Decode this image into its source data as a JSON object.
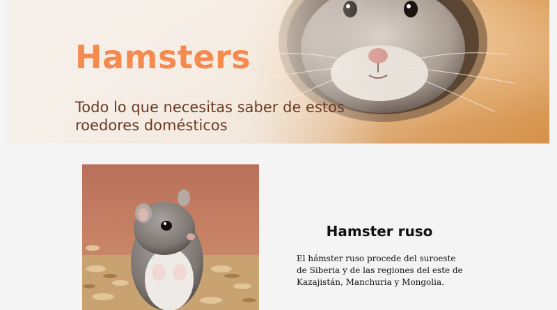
{
  "hero": {
    "title": "Hamsters",
    "subtitle": "Todo lo que necesitas saber de estos roedores domésticos",
    "photo_icon": "hamster-in-tube-photo"
  },
  "card": {
    "title": "Hamster ruso",
    "description": "El hámster ruso procede del suroeste de Siberia y de las regiones del este de Kazajistán, Manchuria y Mongolia.",
    "photo_icon": "russian-hamster-photo"
  },
  "colors": {
    "background": "#f4f4f4",
    "title_orange": "#f58a4f",
    "subtitle_brown": "#6b3a22",
    "text_dark": "#111111"
  }
}
